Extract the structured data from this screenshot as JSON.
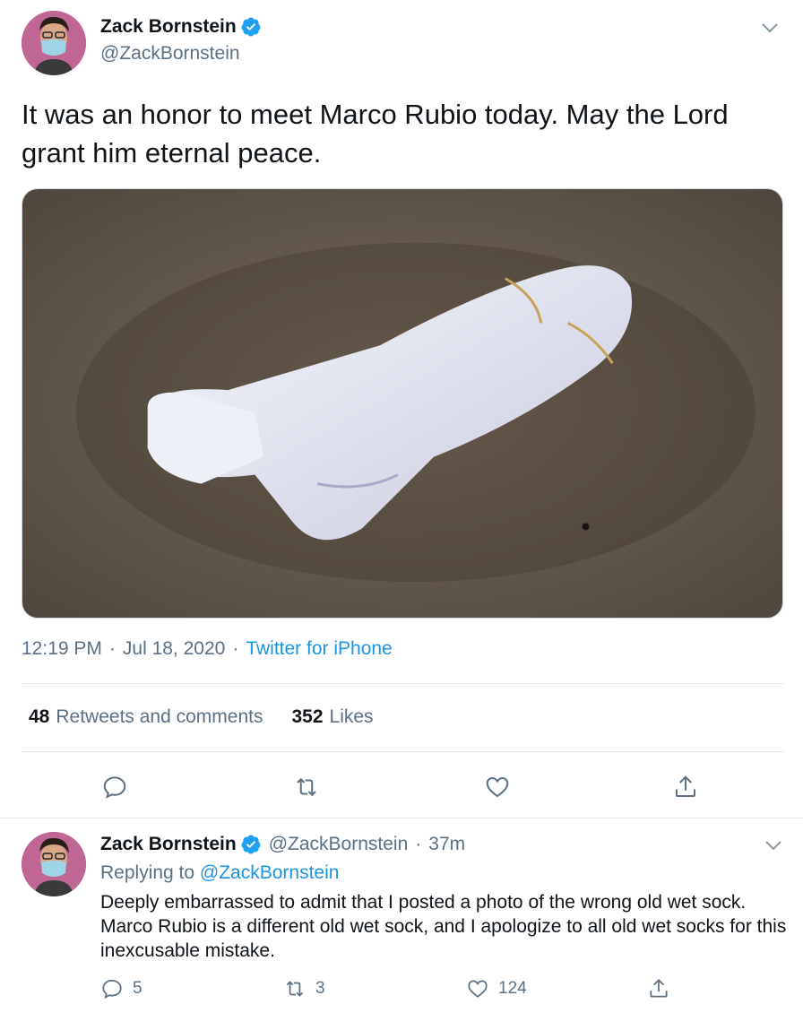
{
  "main_tweet": {
    "author_name": "Zack Bornstein",
    "author_handle": "@ZackBornstein",
    "text": "It was an honor to meet Marco Rubio today. May the Lord grant him eternal peace.",
    "time": "12:19 PM",
    "date": "Jul 18, 2020",
    "source": "Twitter for iPhone",
    "separator": "·",
    "stats": {
      "retweets_count": "48",
      "retweets_label": "Retweets and comments",
      "likes_count": "352",
      "likes_label": "Likes"
    },
    "actions": [
      "reply-icon",
      "retweet-icon",
      "like-icon",
      "share-icon"
    ]
  },
  "reply_tweet": {
    "author_name": "Zack Bornstein",
    "author_handle": "@ZackBornstein",
    "time_ago": "37m",
    "separator": "·",
    "replying_prefix": "Replying to",
    "replying_to": "@ZackBornstein",
    "text": "Deeply embarrassed to admit that I posted a photo of the wrong old wet sock. Marco Rubio is a different old wet sock, and I apologize to all old wet socks for this inexcusable mistake.",
    "reply_count": "5",
    "retweet_count": "3",
    "like_count": "124"
  },
  "colors": {
    "link": "#1b95e0",
    "secondary_text": "#5b7083",
    "verified": "#1da1f2",
    "divider": "#e1e8ed"
  }
}
